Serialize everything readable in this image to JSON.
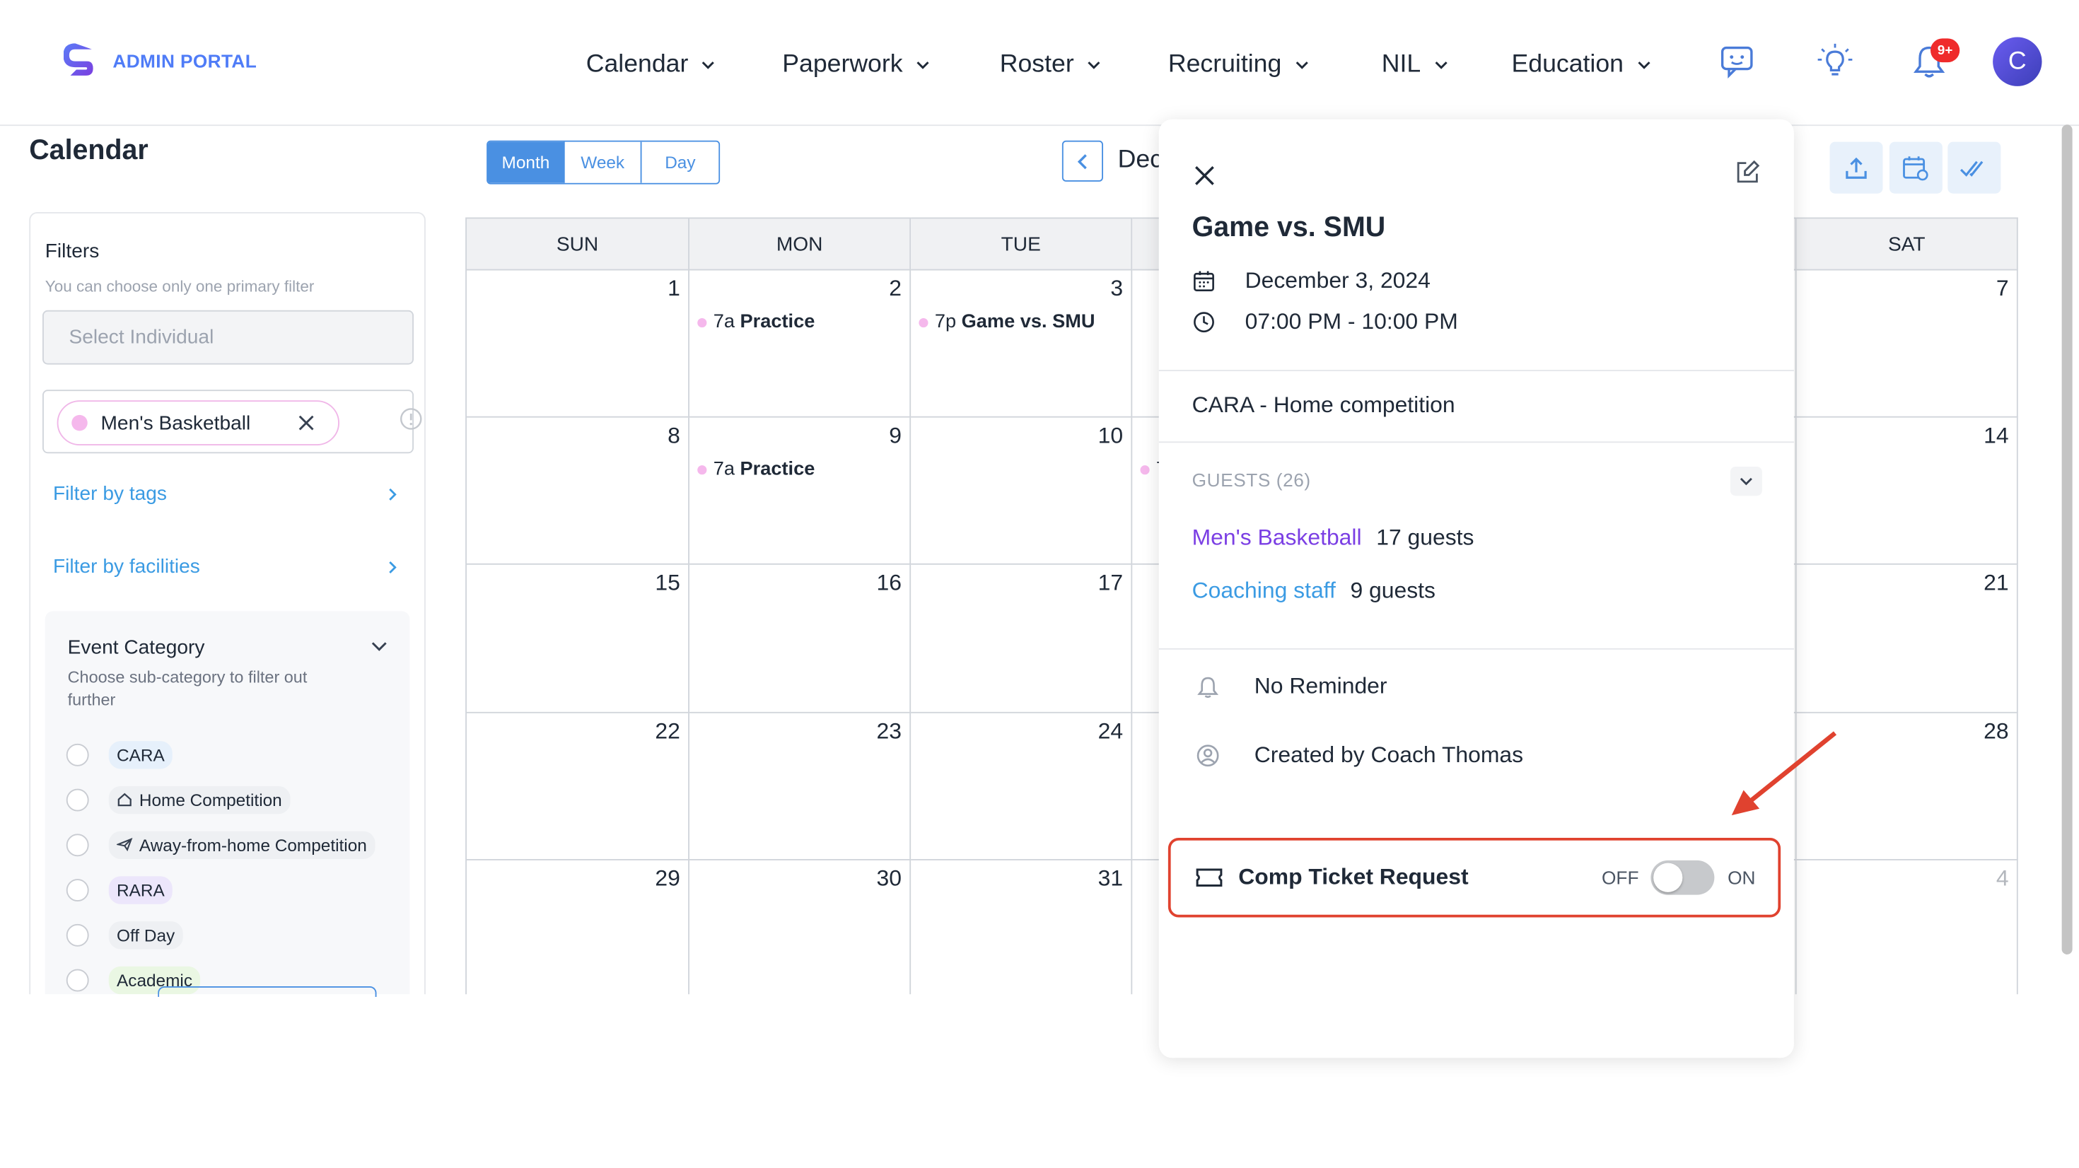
{
  "header": {
    "logo_text": "ADMIN PORTAL",
    "nav": [
      {
        "label": "Calendar"
      },
      {
        "label": "Paperwork"
      },
      {
        "label": "Roster"
      },
      {
        "label": "Recruiting"
      },
      {
        "label": "NIL"
      },
      {
        "label": "Education"
      }
    ],
    "notification_badge": "9+",
    "avatar_initial": "C"
  },
  "page": {
    "title": "Calendar"
  },
  "sidebar": {
    "filters_title": "Filters",
    "filters_hint": "You can choose only one primary filter",
    "select_placeholder": "Select Individual",
    "selected_chip": "Men's Basketball",
    "filter_by_tags": "Filter by tags",
    "filter_by_facilities": "Filter by facilities",
    "event_category": {
      "title": "Event Category",
      "subtitle": "Choose sub-category to filter out further",
      "items": [
        {
          "label": "CARA",
          "color": "#e6f0fb",
          "icon": ""
        },
        {
          "label": "Home Competition",
          "color": "#eef0f3",
          "icon": "home-icon"
        },
        {
          "label": "Away-from-home Competition",
          "color": "#eef0f3",
          "icon": "plane-icon"
        },
        {
          "label": "RARA",
          "color": "#ece6fb",
          "icon": ""
        },
        {
          "label": "Off Day",
          "color": "#eef0f3",
          "icon": ""
        },
        {
          "label": "Academic",
          "color": "#eaf7e3",
          "icon": ""
        }
      ]
    }
  },
  "toolbar": {
    "views": [
      "Month",
      "Week",
      "Day"
    ],
    "active_view": "Month",
    "month_label": "Dec"
  },
  "calendar": {
    "days_of_week": [
      "SUN",
      "MON",
      "TUE",
      "",
      "",
      "",
      "SAT"
    ],
    "weeks": [
      [
        {
          "day": "1"
        },
        {
          "day": "2",
          "event_time": "7a",
          "event_name": "Practice"
        },
        {
          "day": "3",
          "event_time": "7p",
          "event_name": "Game vs. SMU"
        },
        {
          "day": ""
        },
        {
          "day": ""
        },
        {
          "day": ""
        },
        {
          "day": "7"
        }
      ],
      [
        {
          "day": "8"
        },
        {
          "day": "9",
          "event_time": "7a",
          "event_name": "Practice"
        },
        {
          "day": "10"
        },
        {
          "day": "",
          "event_time": "7",
          "event_name": ""
        },
        {
          "day": ""
        },
        {
          "day": ""
        },
        {
          "day": "14"
        }
      ],
      [
        {
          "day": "15"
        },
        {
          "day": "16"
        },
        {
          "day": "17"
        },
        {
          "day": ""
        },
        {
          "day": ""
        },
        {
          "day": ""
        },
        {
          "day": "21"
        }
      ],
      [
        {
          "day": "22"
        },
        {
          "day": "23"
        },
        {
          "day": "24"
        },
        {
          "day": ""
        },
        {
          "day": ""
        },
        {
          "day": ""
        },
        {
          "day": "28"
        }
      ],
      [
        {
          "day": "29"
        },
        {
          "day": "30"
        },
        {
          "day": "31"
        },
        {
          "day": ""
        },
        {
          "day": ""
        },
        {
          "day": ""
        },
        {
          "day": "4",
          "muted": true
        }
      ]
    ],
    "event_color": "#f5b8ec"
  },
  "popover": {
    "title": "Game vs. SMU",
    "date": "December 3, 2024",
    "time": "07:00 PM - 10:00 PM",
    "category": "CARA - Home competition",
    "guests_label": "GUESTS (26)",
    "guests": [
      {
        "group": "Men's Basketball",
        "count": "17 guests",
        "color": "#7b3fe4"
      },
      {
        "group": "Coaching staff",
        "count": "9 guests",
        "color": "#3b9be3"
      }
    ],
    "reminder": "No Reminder",
    "created_by": "Created by Coach Thomas",
    "comp_ticket": {
      "label": "Comp Ticket Request",
      "off_label": "OFF",
      "on_label": "ON",
      "state": "off"
    }
  },
  "colors": {
    "accent": "#4a90e2",
    "highlight": "#e0422f",
    "badge": "#ef2b2b"
  }
}
